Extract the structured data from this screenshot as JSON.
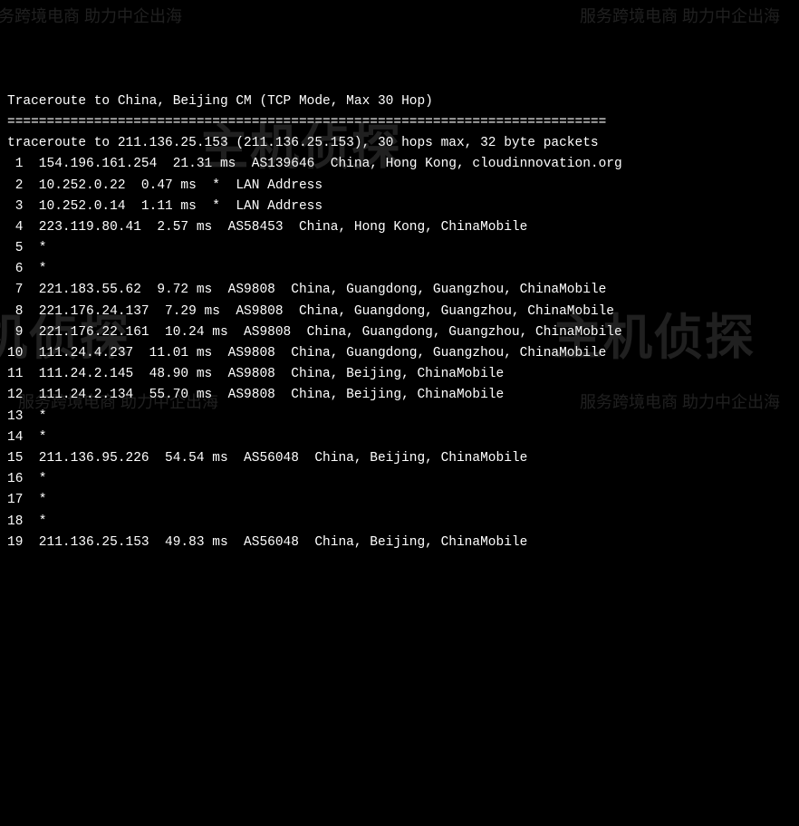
{
  "header": {
    "title": "Traceroute to China, Beijing CM (TCP Mode, Max 30 Hop)",
    "separator": "============================================================================",
    "command": "traceroute to 211.136.25.153 (211.136.25.153), 30 hops max, 32 byte packets"
  },
  "hops": [
    {
      "n": " 1",
      "ip": "154.196.161.254",
      "rtt": "21.31 ms",
      "asn": "AS139646",
      "loc": "China, Hong Kong, cloudinnovation.org"
    },
    {
      "n": " 2",
      "ip": "10.252.0.22",
      "rtt": "0.47 ms",
      "asn": "*",
      "loc": "LAN Address"
    },
    {
      "n": " 3",
      "ip": "10.252.0.14",
      "rtt": "1.11 ms",
      "asn": "*",
      "loc": "LAN Address"
    },
    {
      "n": " 4",
      "ip": "223.119.80.41",
      "rtt": "2.57 ms",
      "asn": "AS58453",
      "loc": "China, Hong Kong, ChinaMobile"
    },
    {
      "n": " 5",
      "ip": "*",
      "rtt": "",
      "asn": "",
      "loc": ""
    },
    {
      "n": " 6",
      "ip": "*",
      "rtt": "",
      "asn": "",
      "loc": ""
    },
    {
      "n": " 7",
      "ip": "221.183.55.62",
      "rtt": "9.72 ms",
      "asn": "AS9808",
      "loc": "China, Guangdong, Guangzhou, ChinaMobile"
    },
    {
      "n": " 8",
      "ip": "221.176.24.137",
      "rtt": "7.29 ms",
      "asn": "AS9808",
      "loc": "China, Guangdong, Guangzhou, ChinaMobile"
    },
    {
      "n": " 9",
      "ip": "221.176.22.161",
      "rtt": "10.24 ms",
      "asn": "AS9808",
      "loc": "China, Guangdong, Guangzhou, ChinaMobile"
    },
    {
      "n": "10",
      "ip": "111.24.4.237",
      "rtt": "11.01 ms",
      "asn": "AS9808",
      "loc": "China, Guangdong, Guangzhou, ChinaMobile"
    },
    {
      "n": "11",
      "ip": "111.24.2.145",
      "rtt": "48.90 ms",
      "asn": "AS9808",
      "loc": "China, Beijing, ChinaMobile"
    },
    {
      "n": "12",
      "ip": "111.24.2.134",
      "rtt": "55.70 ms",
      "asn": "AS9808",
      "loc": "China, Beijing, ChinaMobile"
    },
    {
      "n": "13",
      "ip": "*",
      "rtt": "",
      "asn": "",
      "loc": ""
    },
    {
      "n": "14",
      "ip": "*",
      "rtt": "",
      "asn": "",
      "loc": ""
    },
    {
      "n": "15",
      "ip": "211.136.95.226",
      "rtt": "54.54 ms",
      "asn": "AS56048",
      "loc": "China, Beijing, ChinaMobile"
    },
    {
      "n": "16",
      "ip": "*",
      "rtt": "",
      "asn": "",
      "loc": ""
    },
    {
      "n": "17",
      "ip": "*",
      "rtt": "",
      "asn": "",
      "loc": ""
    },
    {
      "n": "18",
      "ip": "*",
      "rtt": "",
      "asn": "",
      "loc": ""
    },
    {
      "n": "19",
      "ip": "211.136.25.153",
      "rtt": "49.83 ms",
      "asn": "AS56048",
      "loc": "China, Beijing, ChinaMobile"
    }
  ],
  "watermarks": {
    "logo": "主机侦探",
    "sub": "服务跨境电商 助力中企出海"
  }
}
